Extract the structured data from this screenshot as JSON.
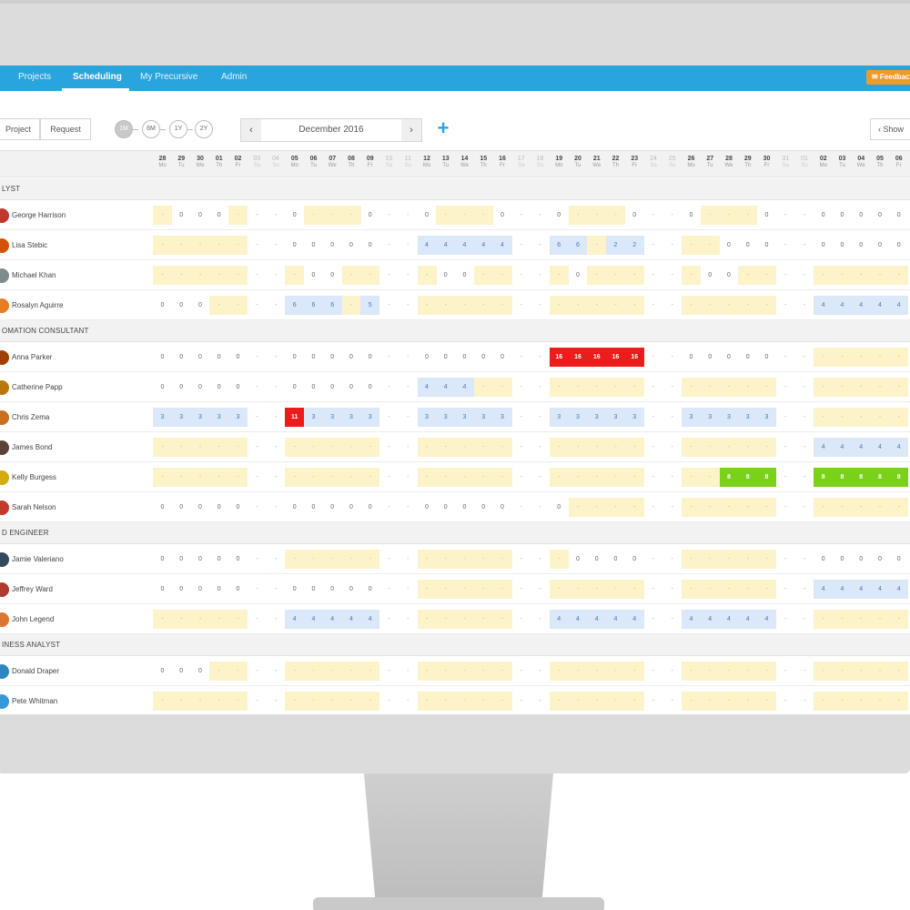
{
  "nav": {
    "items": [
      "Projects",
      "Scheduling",
      "My Precursive",
      "Admin"
    ],
    "active": "Scheduling",
    "feedback": "✉ Feedback"
  },
  "toolbar": {
    "project": "Project",
    "request": "Request",
    "ranges": [
      "1M",
      "6M",
      "1Y",
      "2Y"
    ],
    "active_range": "1M",
    "month": "December 2016",
    "prev": "‹",
    "next": "›",
    "add": "+",
    "show": "‹  Show"
  },
  "dates": [
    {
      "n": "28",
      "d": "Mo"
    },
    {
      "n": "29",
      "d": "Tu"
    },
    {
      "n": "30",
      "d": "We"
    },
    {
      "n": "01",
      "d": "Th"
    },
    {
      "n": "02",
      "d": "Fr"
    },
    {
      "n": "03",
      "d": "Sa",
      "w": true
    },
    {
      "n": "04",
      "d": "Su",
      "w": true
    },
    {
      "n": "05",
      "d": "Mo"
    },
    {
      "n": "06",
      "d": "Tu"
    },
    {
      "n": "07",
      "d": "We"
    },
    {
      "n": "08",
      "d": "Th"
    },
    {
      "n": "09",
      "d": "Fr"
    },
    {
      "n": "10",
      "d": "Sa",
      "w": true
    },
    {
      "n": "11",
      "d": "Su",
      "w": true
    },
    {
      "n": "12",
      "d": "Mo"
    },
    {
      "n": "13",
      "d": "Tu"
    },
    {
      "n": "14",
      "d": "We"
    },
    {
      "n": "15",
      "d": "Th"
    },
    {
      "n": "16",
      "d": "Fr"
    },
    {
      "n": "17",
      "d": "Sa",
      "w": true
    },
    {
      "n": "18",
      "d": "Su",
      "w": true
    },
    {
      "n": "19",
      "d": "Mo"
    },
    {
      "n": "20",
      "d": "Tu"
    },
    {
      "n": "21",
      "d": "We"
    },
    {
      "n": "22",
      "d": "Th"
    },
    {
      "n": "23",
      "d": "Fr"
    },
    {
      "n": "24",
      "d": "Sa",
      "w": true
    },
    {
      "n": "25",
      "d": "Su",
      "w": true
    },
    {
      "n": "26",
      "d": "Mo"
    },
    {
      "n": "27",
      "d": "Tu"
    },
    {
      "n": "28",
      "d": "We"
    },
    {
      "n": "29",
      "d": "Th"
    },
    {
      "n": "30",
      "d": "Fr"
    },
    {
      "n": "31",
      "d": "Sa",
      "w": true
    },
    {
      "n": "01",
      "d": "Su",
      "w": true
    },
    {
      "n": "02",
      "d": "Mo"
    },
    {
      "n": "03",
      "d": "Tu"
    },
    {
      "n": "04",
      "d": "We"
    },
    {
      "n": "05",
      "d": "Th"
    },
    {
      "n": "06",
      "d": "Fr"
    }
  ],
  "groups": [
    {
      "label": "LYST",
      "people": [
        {
          "name": "George Harrison",
          "avatar": "#c0392b",
          "cells": "y.-|0|0|0|y.-|-|-|0|y.-|y.-|y.-|0|-|-|0|y.-|y.-|y.-|0|-|-|0|y.-|y.-|y.-|0|-|-|0|y.-|y.-|y.-|0|-|-|0|0|0|0|0"
        },
        {
          "name": "Lisa Stebic",
          "avatar": "#d35400",
          "cells": "y.-|y.-|y.-|y.-|y.-|-|-|0|0|0|0|0|-|-|b.4|b.4|b.4|b.4|b.4|-|-|b.6|b.6|y.-|b.2|b.2|-|-|y.-|y.-|0|0|0|-|-|0|0|0|0|0"
        },
        {
          "name": "Michael Khan",
          "avatar": "#7f8c8d",
          "cells": "y.-|y.-|y.-|y.-|y.-|-|-|y.-|0|0|y.-|y.-|-|-|y.-|0|0|y.-|y.-|-|-|y.-|0|y.-|y.-|y.-|-|-|y.-|0|0|y.-|y.-|-|-|y.-|y.-|y.-|y.-|y.-"
        },
        {
          "name": "Rosalyn Aguirre",
          "avatar": "#e67e22",
          "cells": "0|0|0|y.-|y.-|-|-|b.6|b.6|b.6|y.-|b.5|-|-|y.-|y.-|y.-|y.-|y.-|-|-|y.-|y.-|y.-|y.-|y.-|-|-|y.-|y.-|y.-|y.-|y.-|-|-|b.4|b.4|b.4|b.4|b.4"
        }
      ]
    },
    {
      "label": "OMATION CONSULTANT",
      "people": [
        {
          "name": "Anna Parker",
          "avatar": "#a04000",
          "cells": "0|0|0|0|0|-|-|0|0|0|0|0|-|-|0|0|0|0|0|-|-|r.16|r.16|r.16|r.16|r.16|-|-|0|0|0|0|0|-|-|y.-|y.-|y.-|y.-|y.-"
        },
        {
          "name": "Catherine Papp",
          "avatar": "#b9770e",
          "cells": "0|0|0|0|0|-|-|0|0|0|0|0|-|-|b.4|b.4|b.4|y.-|y.-|-|-|y.-|y.-|y.-|y.-|y.-|-|-|y.-|y.-|y.-|y.-|y.-|-|-|y.-|y.-|y.-|y.-|y.-"
        },
        {
          "name": "Chris Zema",
          "avatar": "#ca6f1e",
          "cells": "b.3|b.3|b.3|b.3|b.3|-|-|r.11|b.3|b.3|b.3|b.3|-|-|b.3|b.3|b.3|b.3|b.3|-|-|b.3|b.3|b.3|b.3|b.3|-|-|b.3|b.3|b.3|b.3|b.3|-|-|y.-|y.-|y.-|y.-|y.-"
        },
        {
          "name": "James Bond",
          "avatar": "#5d4037",
          "cells": "y.-|y.-|y.-|y.-|y.-|-|-|y.-|y.-|y.-|y.-|y.-|-|-|y.-|y.-|y.-|y.-|y.-|-|-|y.-|y.-|y.-|y.-|y.-|-|-|y.-|y.-|y.-|y.-|y.-|-|-|b.4|b.4|b.4|b.4|b.4"
        },
        {
          "name": "Kelly Burgess",
          "avatar": "#d4ac0d",
          "cells": "y.-|y.-|y.-|y.-|y.-|-|-|y.-|y.-|y.-|y.-|y.-|-|-|y.-|y.-|y.-|y.-|y.-|-|-|y.-|y.-|y.-|y.-|y.-|-|-|y.-|y.-|g.8|g.8|g.8|-|-|g.8|g.8|g.8|g.8|g.8"
        },
        {
          "name": "Sarah Nelson",
          "avatar": "#c0392b",
          "cells": "0|0|0|0|0|-|-|0|0|0|0|0|-|-|0|0|0|0|0|-|-|0|y.-|y.-|y.-|y.-|-|-|y.-|y.-|y.-|y.-|y.-|-|-|y.-|y.-|y.-|y.-|y.-"
        }
      ]
    },
    {
      "label": "D ENGINEER",
      "people": [
        {
          "name": "Jamie Valeriano",
          "avatar": "#34495e",
          "cells": "0|0|0|0|0|-|-|y.-|y.-|y.-|y.-|y.-|-|-|y.-|y.-|y.-|y.-|y.-|-|-|y.-|0|0|0|0|-|-|y.-|y.-|y.-|y.-|y.-|-|-|0|0|0|0|0"
        },
        {
          "name": "Jeffrey Ward",
          "avatar": "#b03a2e",
          "cells": "0|0|0|0|0|-|-|0|0|0|0|0|-|-|y.-|y.-|y.-|y.-|y.-|-|-|y.-|y.-|y.-|y.-|y.-|-|-|y.-|y.-|y.-|y.-|y.-|-|-|b.4|b.4|b.4|b.4|b.4"
        },
        {
          "name": "John Legend",
          "avatar": "#dc7633",
          "cells": "y.-|y.-|y.-|y.-|y.-|-|-|b.4|b.4|b.4|b.4|b.4|-|-|y.-|y.-|y.-|y.-|y.-|-|-|b.4|b.4|b.4|b.4|b.4|-|-|b.4|b.4|b.4|b.4|b.4|-|-|y.-|y.-|y.-|y.-|y.-"
        }
      ]
    },
    {
      "label": "INESS ANALYST",
      "people": [
        {
          "name": "Donald Draper",
          "avatar": "#2e86c1",
          "cells": "0|0|0|y.-|y.-|-|-|y.-|y.-|y.-|y.-|y.-|-|-|y.-|y.-|y.-|y.-|y.-|-|-|y.-|y.-|y.-|y.-|y.-|-|-|y.-|y.-|y.-|y.-|y.-|-|-|y.-|y.-|y.-|y.-|y.-"
        },
        {
          "name": "Pete Whitman",
          "avatar": "#3498db",
          "cells": "y.-|y.-|y.-|y.-|y.-|-|-|y.-|y.-|y.-|y.-|y.-|-|-|y.-|y.-|y.-|y.-|y.-|-|-|y.-|y.-|y.-|y.-|y.-|-|-|y.-|y.-|y.-|y.-|y.-|-|-|y.-|y.-|y.-|y.-|y.-"
        }
      ]
    }
  ]
}
